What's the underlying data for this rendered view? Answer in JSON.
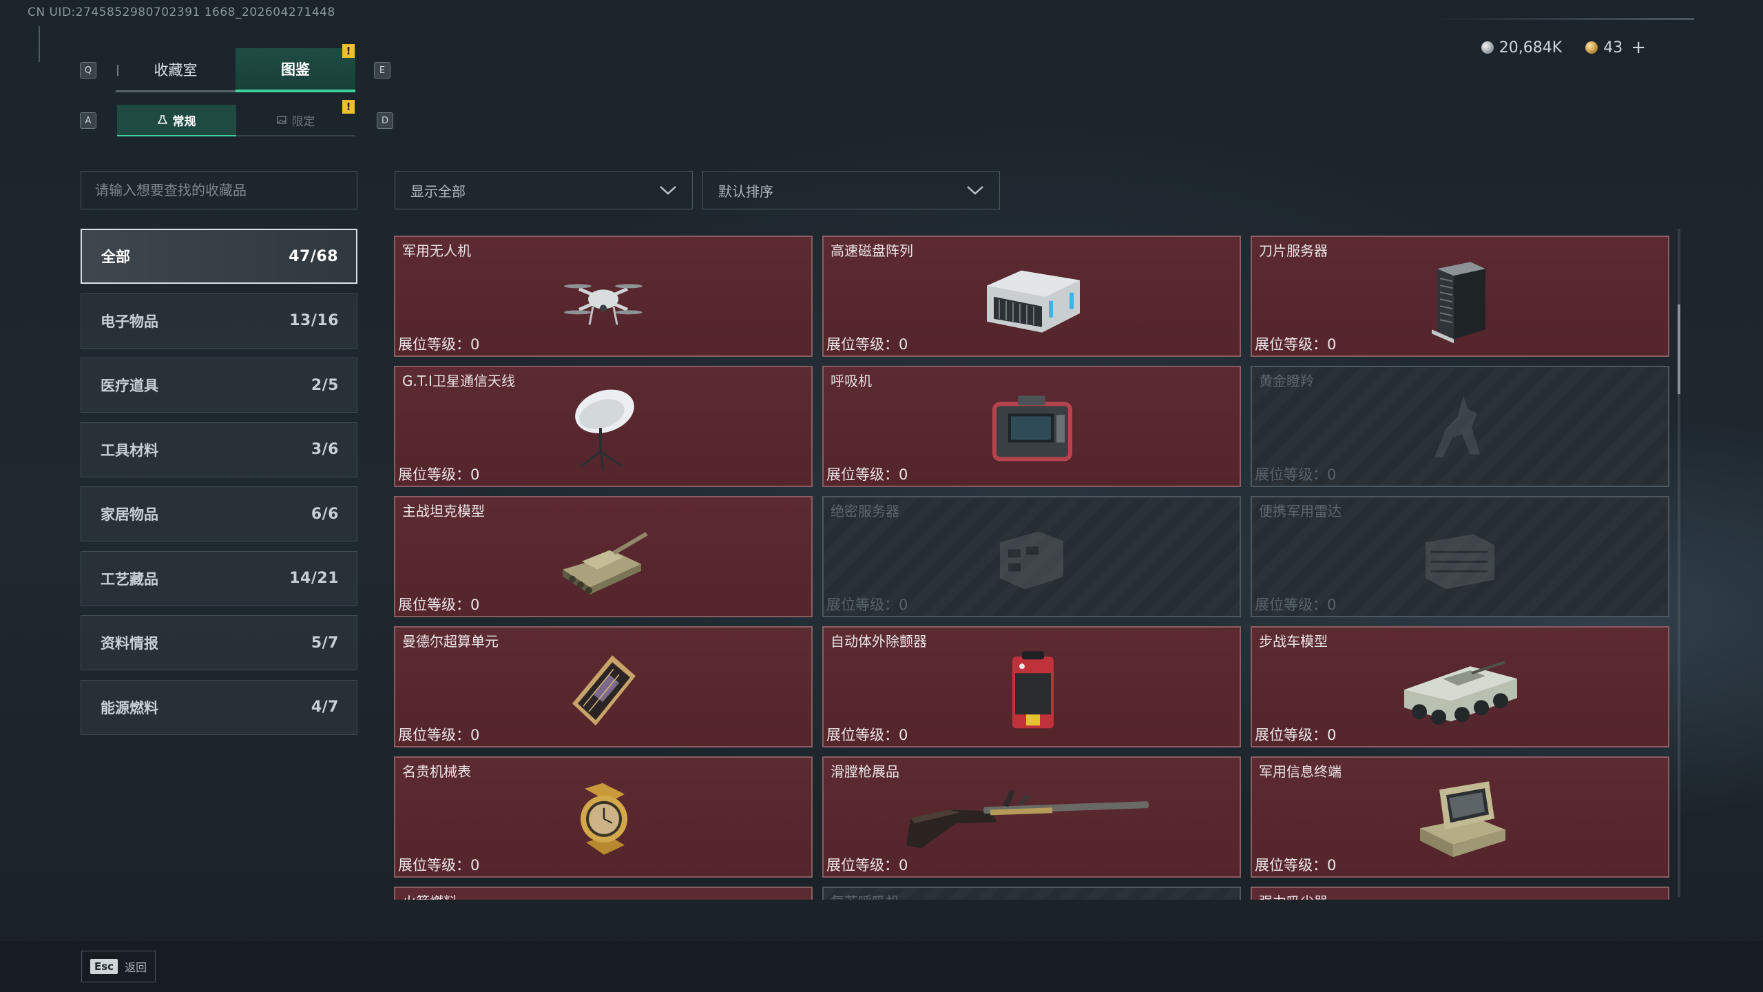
{
  "uid_text": "CN UID:2745852980702391 1668_202604271448",
  "currency": {
    "silver": "20,684K",
    "gold": "43",
    "plus": "+"
  },
  "keys": {
    "prev_tab": "Q",
    "next_tab": "E",
    "prev_sub": "A",
    "next_sub": "D"
  },
  "tabs": [
    {
      "label": "收藏室"
    },
    {
      "label": "图鉴"
    }
  ],
  "tab_warning": "!",
  "subtabs": [
    {
      "label": "常规"
    },
    {
      "label": "限定"
    }
  ],
  "search": {
    "placeholder": "请输入想要查找的收藏品"
  },
  "filters": {
    "display": "显示全部",
    "sort": "默认排序"
  },
  "categories": [
    {
      "label": "全部",
      "count": "47/68"
    },
    {
      "label": "电子物品",
      "count": "13/16"
    },
    {
      "label": "医疗道具",
      "count": "2/5"
    },
    {
      "label": "工具材料",
      "count": "3/6"
    },
    {
      "label": "家居物品",
      "count": "6/6"
    },
    {
      "label": "工艺藏品",
      "count": "14/21"
    },
    {
      "label": "资料情报",
      "count": "5/7"
    },
    {
      "label": "能源燃料",
      "count": "4/7"
    }
  ],
  "level_label": "展位等级：",
  "items": [
    {
      "name": "军用无人机",
      "level": "0",
      "locked": false,
      "icon": "drone-icon"
    },
    {
      "name": "高速磁盘阵列",
      "level": "0",
      "locked": false,
      "icon": "disk-array-icon"
    },
    {
      "name": "刀片服务器",
      "level": "0",
      "locked": false,
      "icon": "blade-server-icon"
    },
    {
      "name": "G.T.I卫星通信天线",
      "level": "0",
      "locked": false,
      "icon": "satellite-dish-icon"
    },
    {
      "name": "呼吸机",
      "level": "0",
      "locked": false,
      "icon": "ventilator-icon"
    },
    {
      "name": "黄金瞪羚",
      "level": "0",
      "locked": true,
      "icon": "gazelle-icon"
    },
    {
      "name": "主战坦克模型",
      "level": "0",
      "locked": false,
      "icon": "tank-icon"
    },
    {
      "name": "绝密服务器",
      "level": "0",
      "locked": true,
      "icon": "secret-server-icon"
    },
    {
      "name": "便携军用雷达",
      "level": "0",
      "locked": true,
      "icon": "radar-icon"
    },
    {
      "name": "曼德尔超算单元",
      "level": "0",
      "locked": false,
      "icon": "supercompute-icon"
    },
    {
      "name": "自动体外除颤器",
      "level": "0",
      "locked": false,
      "icon": "defibrillator-icon"
    },
    {
      "name": "步战车模型",
      "level": "0",
      "locked": false,
      "icon": "ifv-icon"
    },
    {
      "name": "名贵机械表",
      "level": "0",
      "locked": false,
      "icon": "watch-icon"
    },
    {
      "name": "滑膛枪展品",
      "level": "0",
      "locked": false,
      "icon": "musket-icon"
    },
    {
      "name": "军用信息终端",
      "level": "0",
      "locked": false,
      "icon": "terminal-icon"
    },
    {
      "name": "火箭燃料",
      "level": "",
      "locked": false,
      "icon": "fuel-icon"
    },
    {
      "name": "复苏呼吸机",
      "level": "",
      "locked": true,
      "icon": "respirator-icon"
    },
    {
      "name": "强力吸尘器",
      "level": "",
      "locked": false,
      "icon": "vacuum-icon"
    }
  ],
  "footer": {
    "esc_key": "Esc",
    "back": "返回"
  }
}
